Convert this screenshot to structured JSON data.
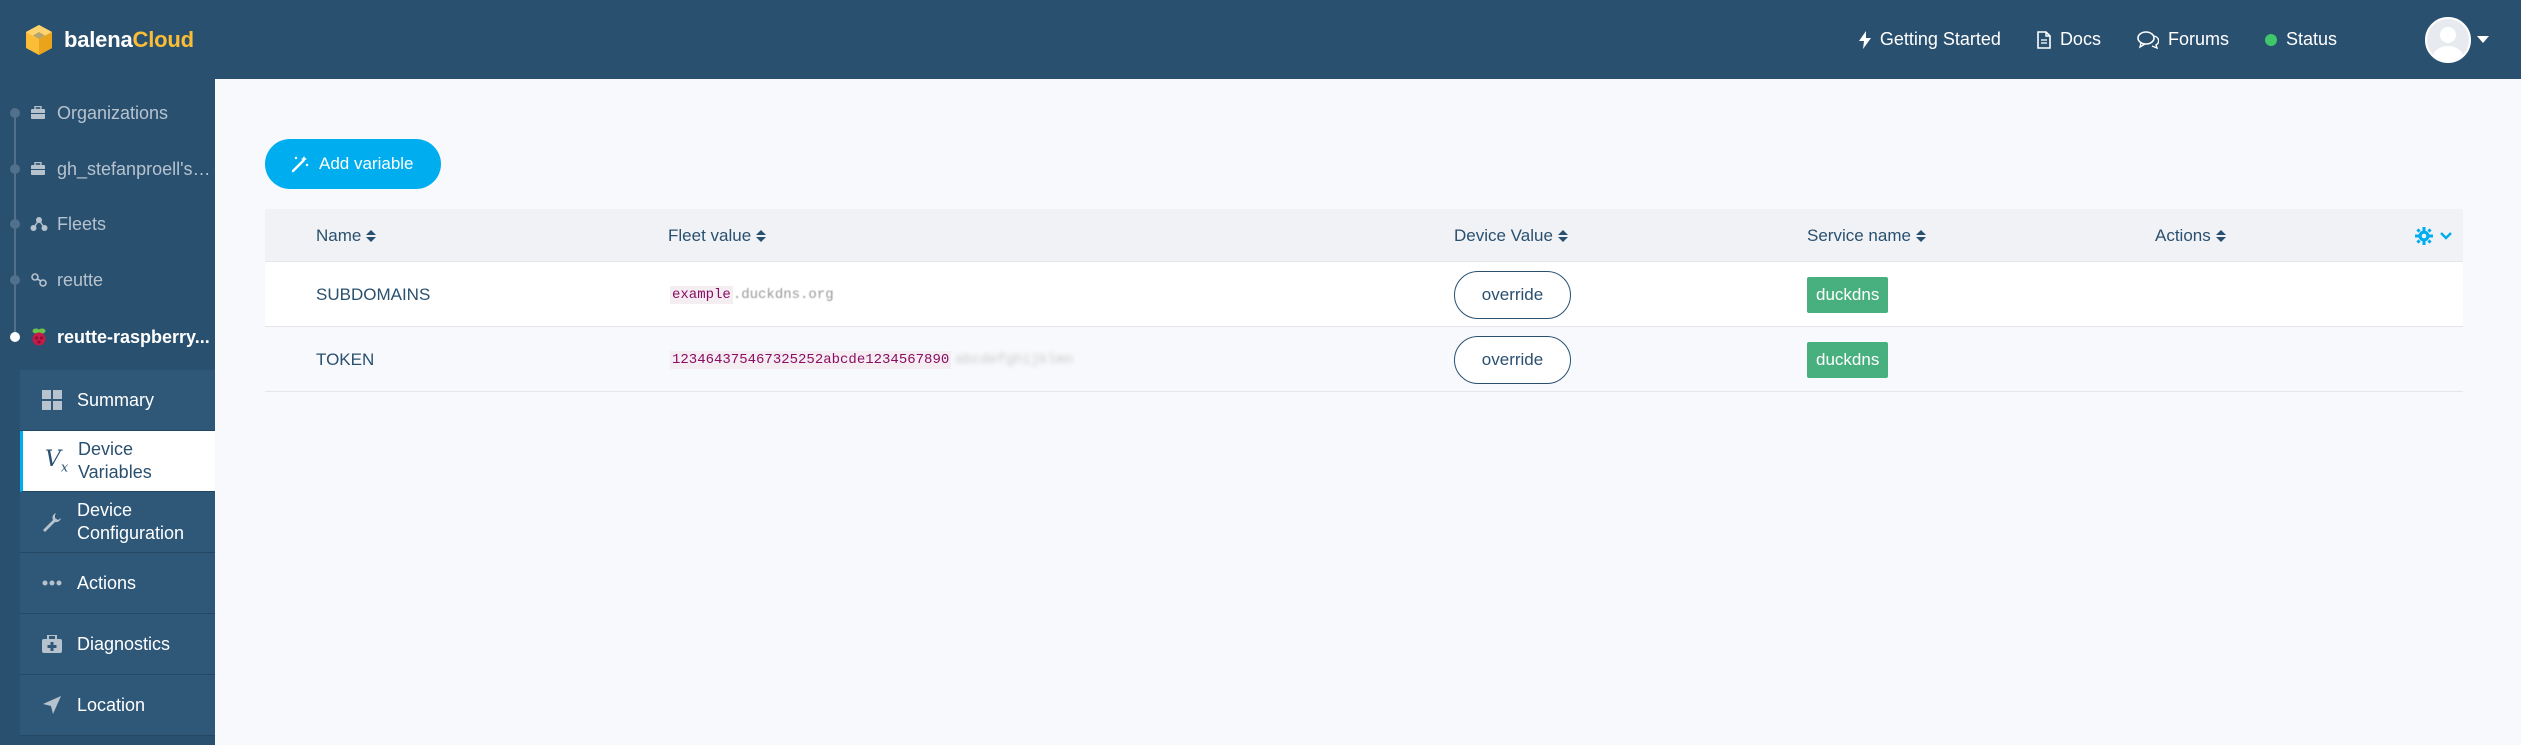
{
  "app": {
    "logo_primary": "balena",
    "logo_accent": "Cloud"
  },
  "topnav": {
    "getting_started": "Getting Started",
    "docs": "Docs",
    "forums": "Forums",
    "status": "Status",
    "status_color": "#3ec86a"
  },
  "sidebar": {
    "breadcrumbs": [
      {
        "label": "Organizations",
        "icon": "briefcase-icon"
      },
      {
        "label": "gh_stefanproell's ...",
        "icon": "briefcase-icon"
      },
      {
        "label": "Fleets",
        "icon": "fleets-icon"
      },
      {
        "label": "reutte",
        "icon": "fleet-icon"
      },
      {
        "label": "reutte-raspberry...",
        "icon": "raspberry-pi-icon"
      }
    ],
    "items": [
      {
        "label": "Summary",
        "icon": "grid-icon"
      },
      {
        "label": "Device\nVariables",
        "icon": "variable-icon",
        "active": true
      },
      {
        "label": "Device\nConfiguration",
        "icon": "wrench-icon"
      },
      {
        "label": "Actions",
        "icon": "dots-icon"
      },
      {
        "label": "Diagnostics",
        "icon": "medkit-icon"
      },
      {
        "label": "Location",
        "icon": "location-arrow-icon"
      }
    ]
  },
  "main": {
    "add_variable_label": "Add variable",
    "columns": {
      "name": "Name",
      "fleet_value": "Fleet value",
      "device_value": "Device Value",
      "service_name": "Service name",
      "actions": "Actions"
    },
    "rows": [
      {
        "name": "SUBDOMAINS",
        "fleet_value_highlight": "example",
        "fleet_value_rest": ".duckdns.org",
        "fleet_value_faded": "",
        "device_value_button": "override",
        "service": "duckdns"
      },
      {
        "name": "TOKEN",
        "fleet_value_highlight": "123464375467325252abcde1234567890",
        "fleet_value_rest": "",
        "fleet_value_faded": "abcdefghijklmn",
        "device_value_button": "override",
        "service": "duckdns"
      }
    ]
  },
  "colors": {
    "navy": "#2a506f",
    "accent_blue": "#00aeef",
    "tag_green": "#48b07e",
    "logo_yellow": "#fbbd36"
  }
}
